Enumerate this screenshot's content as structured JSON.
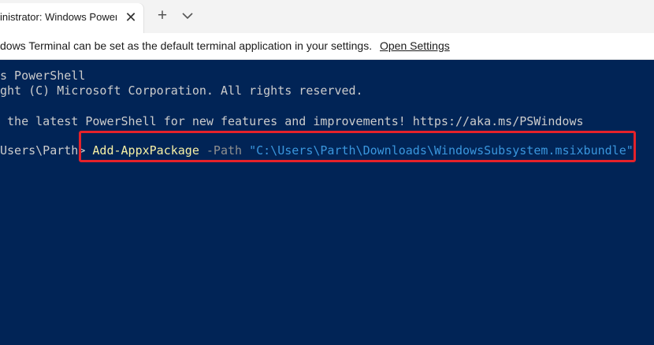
{
  "tab": {
    "title": "inistrator: Windows PowerS",
    "close_icon": "close-icon",
    "new_tab_icon": "plus-icon",
    "dropdown_icon": "chevron-down-icon"
  },
  "infobar": {
    "message": "dows Terminal can be set as the default terminal application in your settings.",
    "link_label": "Open Settings"
  },
  "terminal": {
    "line1": "s PowerShell",
    "line2": "ght (C) Microsoft Corporation. All rights reserved.",
    "line3": " the latest PowerShell for new features and improvements! https://aka.ms/PSWindows",
    "prompt": "Users\\Parth> ",
    "command": "Add-AppxPackage",
    "parameter": " -Path ",
    "argument": "\"C:\\Users\\Parth\\Downloads\\WindowsSubsystem.msixbundle\""
  },
  "colors": {
    "background": "#012456",
    "highlight": "#e5222a",
    "cmdlet": "#f9f1a5",
    "string": "#3a96dd"
  }
}
